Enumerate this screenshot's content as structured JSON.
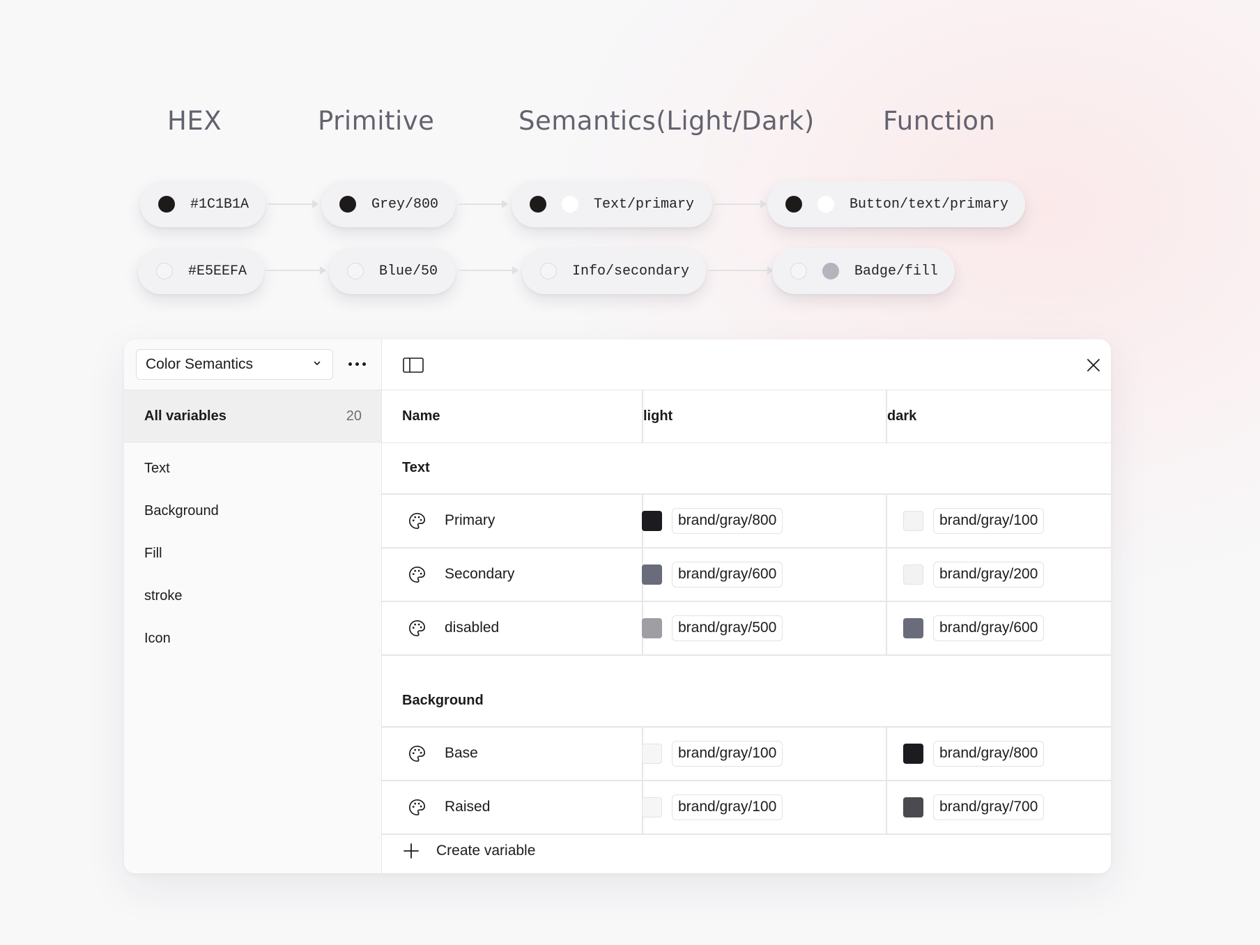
{
  "flow": {
    "headings": [
      "HEX",
      "Primitive",
      "Semantics(Light/Dark)",
      "Function"
    ],
    "row1": {
      "hex": "#1C1B1A",
      "primitive": "Grey/800",
      "semantic": "Text/primary",
      "function": "Button/text/primary"
    },
    "row2": {
      "hex": "#E5EEFA",
      "primitive": "Blue/50",
      "semantic": "Info/secondary",
      "function": "Badge/fill"
    }
  },
  "panel": {
    "collection_select": "Color Semantics",
    "all_variables": {
      "label": "All variables",
      "count": "20"
    },
    "groups": [
      "Text",
      "Background",
      "Fill",
      "stroke",
      "Icon"
    ],
    "columns": {
      "name": "Name",
      "light": "light",
      "dark": "dark"
    },
    "sections": [
      {
        "title": "Text",
        "rows": [
          {
            "name": "Primary",
            "light": {
              "ref": "brand/gray/800",
              "color": "#1c1b1f"
            },
            "dark": {
              "ref": "brand/gray/100",
              "color": "#f4f4f5"
            }
          },
          {
            "name": "Secondary",
            "light": {
              "ref": "brand/gray/600",
              "color": "#6a6b7b"
            },
            "dark": {
              "ref": "brand/gray/200",
              "color": "#f2f2f3"
            }
          },
          {
            "name": "disabled",
            "light": {
              "ref": "brand/gray/500",
              "color": "#9e9ea3"
            },
            "dark": {
              "ref": "brand/gray/600",
              "color": "#6a6b7b"
            }
          }
        ]
      },
      {
        "title": "Background",
        "rows": [
          {
            "name": "Base",
            "light": {
              "ref": "brand/gray/100",
              "color": "#f6f6f7"
            },
            "dark": {
              "ref": "brand/gray/800",
              "color": "#1c1b1f"
            }
          },
          {
            "name": "Raised",
            "light": {
              "ref": "brand/gray/100",
              "color": "#f6f6f7"
            },
            "dark": {
              "ref": "brand/gray/700",
              "color": "#4a4a4f"
            }
          }
        ]
      }
    ],
    "create_variable": "Create variable"
  },
  "icons": {
    "chevron": "chevron-down-icon",
    "more": "more-horizontal-icon",
    "sidebar_toggle": "sidebar-toggle-icon",
    "close": "close-icon",
    "palette": "palette-icon",
    "plus": "plus-icon"
  }
}
